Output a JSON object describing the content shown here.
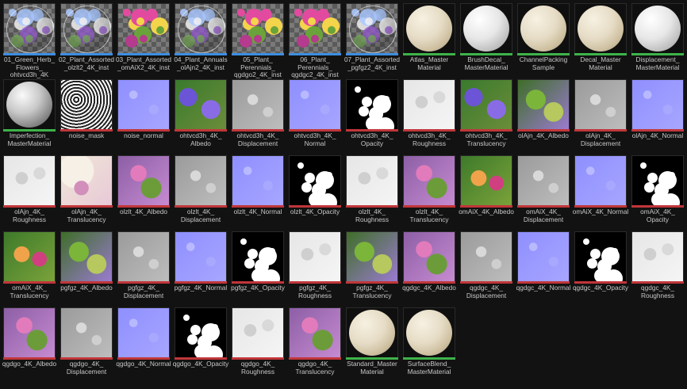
{
  "assets": [
    {
      "label": "01_Green_Herb_\nFlowers_\nohtvcd3h_4K",
      "type": "glass",
      "bar": "#3d8ee0"
    },
    {
      "label": "02_Plant_Assorted\n_olzlt2_4K_inst",
      "type": "glass",
      "bar": "#3d8ee0"
    },
    {
      "label": "03_Plant_Assorted\n_omAiX2_4K_inst",
      "type": "plant",
      "bar": "#3d8ee0"
    },
    {
      "label": "04_Plant_Annuals\n_olAjn2_4K_inst",
      "type": "glass",
      "bar": "#3d8ee0"
    },
    {
      "label": "05_Plant_\nPerennials_\nqgdgo2_4K_inst",
      "type": "plant",
      "bar": "#3d8ee0"
    },
    {
      "label": "06_Plant_\nPerennials_\nqgdgc2_4K_inst",
      "type": "plant",
      "bar": "#3d8ee0"
    },
    {
      "label": "07_Plant_Assorted\n_pgfgz2_4K_inst",
      "type": "glass",
      "bar": "#3d8ee0"
    },
    {
      "label": "Atlas_Master\nMaterial",
      "type": "sphere_cream",
      "bar": "#3eb34a"
    },
    {
      "label": "BrushDecal_\nMasterMaterial",
      "type": "sphere_white",
      "bar": "#3eb34a"
    },
    {
      "label": "ChannelPacking\nSample",
      "type": "sphere_cream",
      "bar": "#3eb34a"
    },
    {
      "label": "Decal_Master\nMaterial",
      "type": "sphere_cream",
      "bar": "#3eb34a"
    },
    {
      "label": "Displacement_\nMasterMaterial",
      "type": "sphere_white",
      "bar": "#3eb34a"
    },
    {
      "label": "Imperfection_\nMasterMaterial",
      "type": "sphere_metal",
      "bar": "#3eb34a"
    },
    {
      "label": "noise_mask",
      "type": "noise",
      "bar": "#c0363a"
    },
    {
      "label": "noise_normal",
      "type": "normal",
      "bar": "#c0363a"
    },
    {
      "label": "ohtvcd3h_4K_\nAlbedo",
      "type": "albedo_purple",
      "bar": "#c0363a"
    },
    {
      "label": "ohtvcd3h_4K_\nDisplacement",
      "type": "displacement",
      "bar": "#c0363a"
    },
    {
      "label": "ohtvcd3h_4K_\nNormal",
      "type": "normal",
      "bar": "#c0363a"
    },
    {
      "label": "ohtvcd3h_4K_\nOpacity",
      "type": "opacity",
      "bar": "#c0363a"
    },
    {
      "label": "ohtvcd3h_4K_\nRoughness",
      "type": "roughness",
      "bar": "#c0363a"
    },
    {
      "label": "ohtvcd3h_4K_\nTranslucency",
      "type": "albedo_purple",
      "bar": "#c0363a"
    },
    {
      "label": "olAjn_4K_Albedo",
      "type": "albedo_green",
      "bar": "#c0363a"
    },
    {
      "label": "olAjn_4K_\nDisplacement",
      "type": "displacement",
      "bar": "#c0363a"
    },
    {
      "label": "olAjn_4K_Normal",
      "type": "normal",
      "bar": "#c0363a"
    },
    {
      "label": "olAjn_4K_\nRoughness",
      "type": "roughness",
      "bar": "#c0363a"
    },
    {
      "label": "olAjn_4K_\nTranslucency",
      "type": "translucent_white",
      "bar": "#c0363a"
    },
    {
      "label": "olzlt_4K_Albedo",
      "type": "albedo_pink",
      "bar": "#c0363a"
    },
    {
      "label": "olzlt_4K_\nDisplacement",
      "type": "displacement",
      "bar": "#c0363a"
    },
    {
      "label": "olzlt_4K_Normal",
      "type": "normal",
      "bar": "#c0363a"
    },
    {
      "label": "olzlt_4K_Opacity",
      "type": "opacity",
      "bar": "#c0363a"
    },
    {
      "label": "olzlt_4K_\nRoughness",
      "type": "roughness",
      "bar": "#c0363a"
    },
    {
      "label": "olzlt_4K_\nTranslucency",
      "type": "albedo_pink",
      "bar": "#c0363a"
    },
    {
      "label": "omAiX_4K_Albedo",
      "type": "albedo_warm",
      "bar": "#c0363a"
    },
    {
      "label": "omAiX_4K_\nDisplacement",
      "type": "displacement",
      "bar": "#c0363a"
    },
    {
      "label": "omAiX_4K_Normal",
      "type": "normal",
      "bar": "#c0363a"
    },
    {
      "label": "omAiX_4K_\nOpacity",
      "type": "opacity",
      "bar": "#c0363a"
    },
    {
      "label": "omAiX_4K_\nTranslucency",
      "type": "albedo_warm",
      "bar": "#c0363a"
    },
    {
      "label": "pgfgz_4K_Albedo",
      "type": "albedo_green",
      "bar": "#c0363a"
    },
    {
      "label": "pgfgz_4K_\nDisplacement",
      "type": "displacement",
      "bar": "#c0363a"
    },
    {
      "label": "pgfgz_4K_Normal",
      "type": "normal",
      "bar": "#c0363a"
    },
    {
      "label": "pgfgz_4K_Opacity",
      "type": "opacity",
      "bar": "#c0363a"
    },
    {
      "label": "pgfgz_4K_\nRoughness",
      "type": "roughness",
      "bar": "#c0363a"
    },
    {
      "label": "pgfgz_4K_\nTranslucency",
      "type": "albedo_green",
      "bar": "#c0363a"
    },
    {
      "label": "qgdgc_4K_Albedo",
      "type": "albedo_pink",
      "bar": "#c0363a"
    },
    {
      "label": "qgdgc_4K_\nDisplacement",
      "type": "displacement",
      "bar": "#c0363a"
    },
    {
      "label": "qgdgc_4K_Normal",
      "type": "normal",
      "bar": "#c0363a"
    },
    {
      "label": "qgdgc_4K_Opacity",
      "type": "opacity",
      "bar": "#c0363a"
    },
    {
      "label": "qgdgc_4K_\nRoughness",
      "type": "roughness",
      "bar": "#c0363a"
    },
    {
      "label": "qgdgo_4K_Albedo",
      "type": "albedo_pink",
      "bar": "#c0363a"
    },
    {
      "label": "qgdgo_4K_\nDisplacement",
      "type": "displacement",
      "bar": "#c0363a"
    },
    {
      "label": "qgdgo_4K_Normal",
      "type": "normal",
      "bar": "#c0363a"
    },
    {
      "label": "qgdgo_4K_Opacity",
      "type": "opacity",
      "bar": "#c0363a"
    },
    {
      "label": "qgdgo_4K_\nRoughness",
      "type": "roughness",
      "bar": "#c0363a"
    },
    {
      "label": "qgdgo_4K_\nTranslucency",
      "type": "albedo_pink",
      "bar": "#c0363a"
    },
    {
      "label": "Standard_Master\nMaterial",
      "type": "sphere_cream",
      "bar": "#3eb34a"
    },
    {
      "label": "SurfaceBlend_\nMasterMaterial",
      "type": "sphere_cream",
      "bar": "#3eb34a"
    }
  ]
}
